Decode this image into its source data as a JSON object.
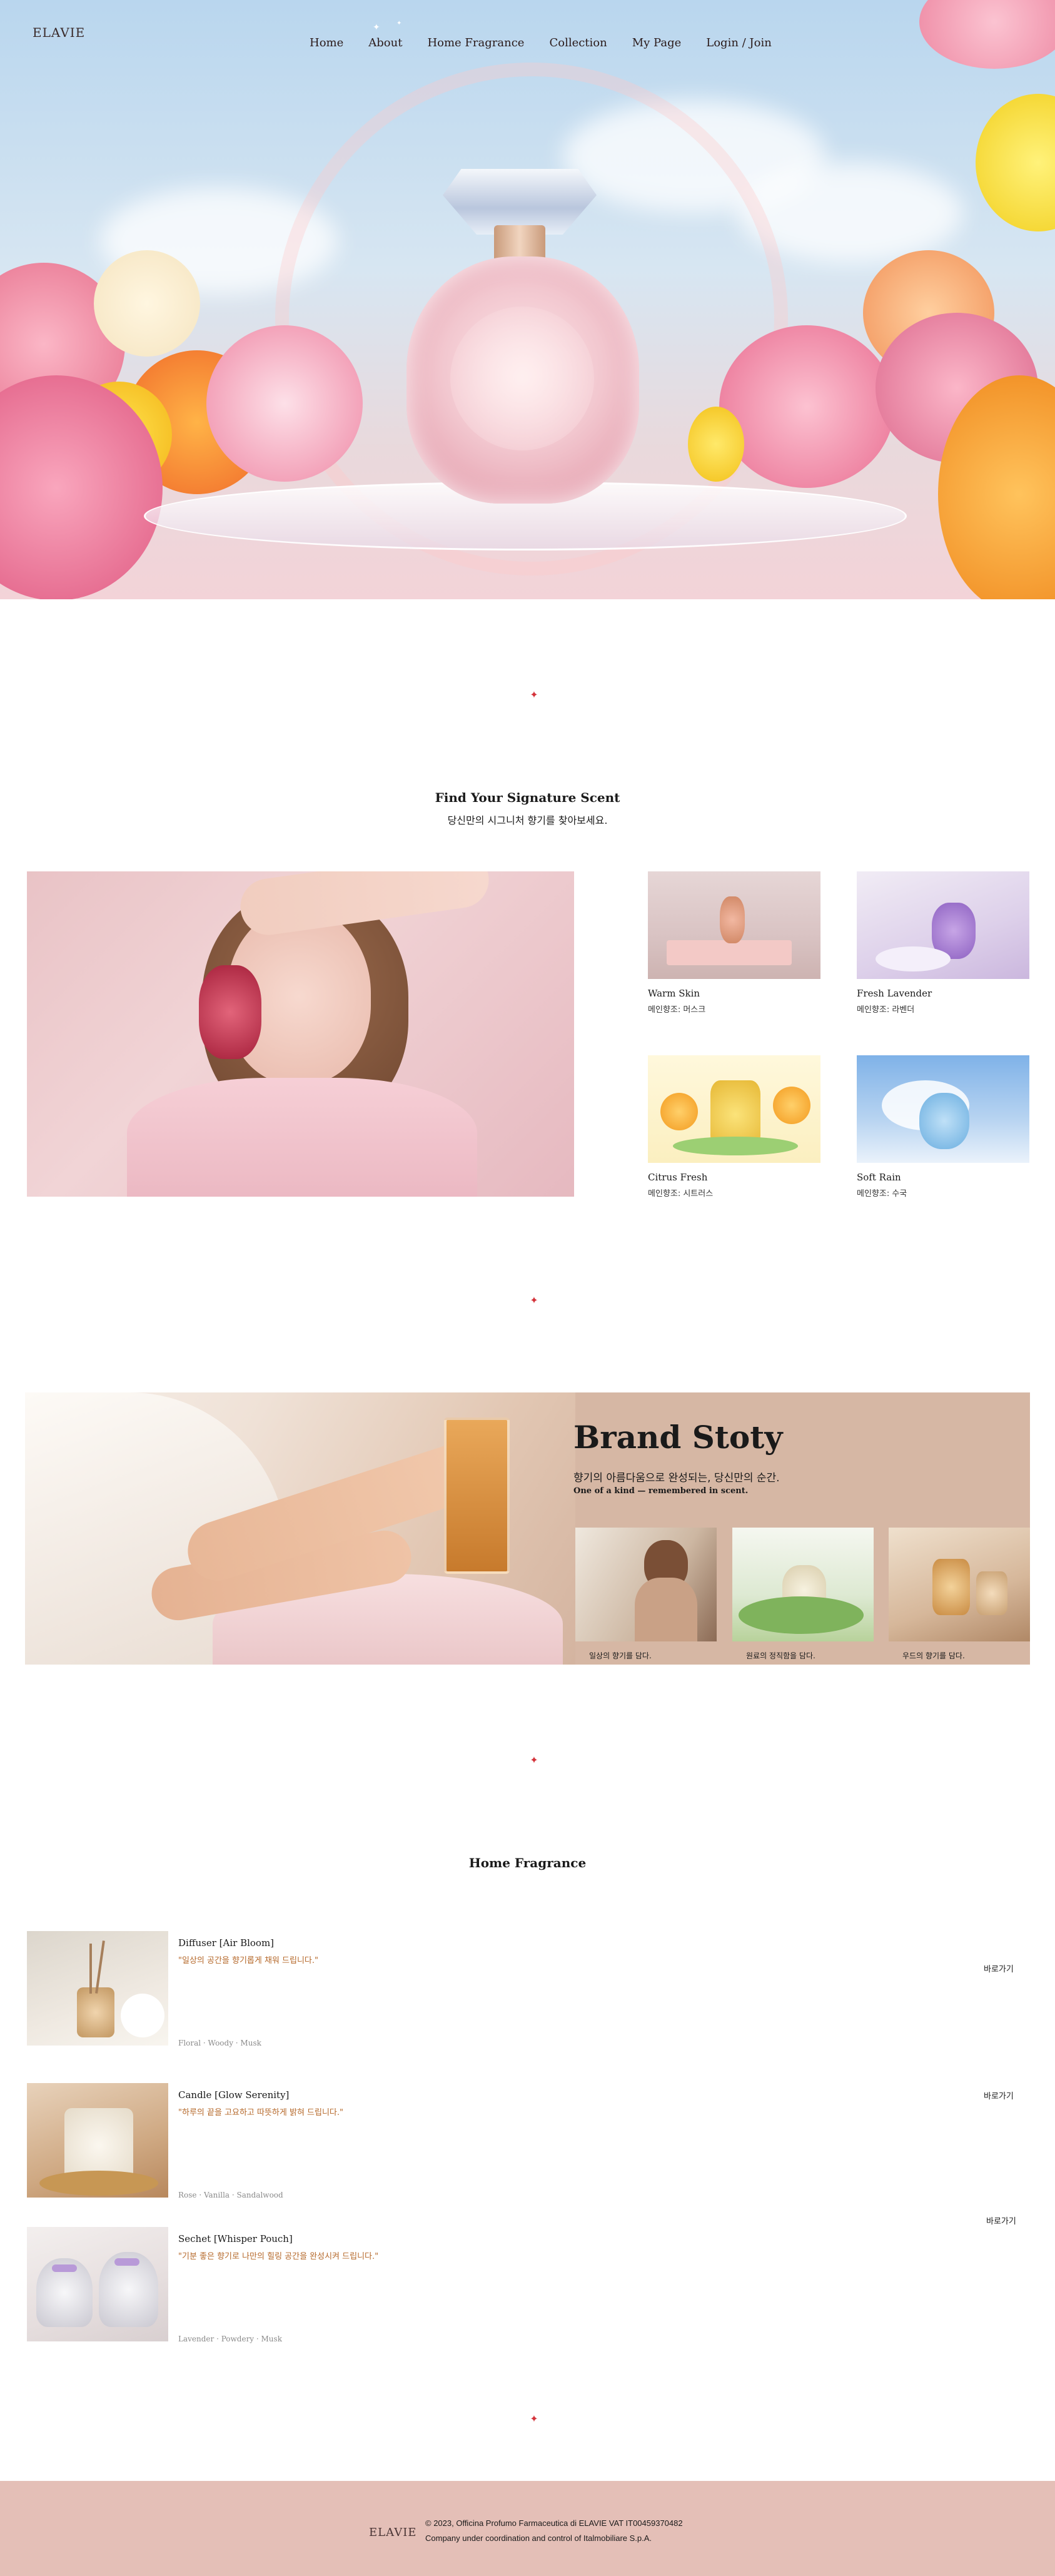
{
  "header": {
    "logo": "ELAVIE",
    "nav": [
      "Home",
      "About",
      "Home Fragrance",
      "Collection",
      "My Page",
      "Login / Join"
    ]
  },
  "divider_icon": "red-sparkle-icon",
  "scent_section": {
    "title": "Find Your Signature Scent",
    "subtitle": "당신만의 시그니처 향기를 찾아보세요.",
    "cards": [
      {
        "name": "Warm Skin",
        "note": "메인향조: 머스크"
      },
      {
        "name": "Fresh Lavender",
        "note": "메인향조: 라벤더"
      },
      {
        "name": "Citrus Fresh",
        "note": "메인향조: 시트러스"
      },
      {
        "name": "Soft Rain",
        "note": "메인향조: 수국"
      }
    ]
  },
  "brand_story": {
    "title": "Brand Stoty",
    "ko": "향기의 아름다움으로 완성되는, 당신만의 순간.",
    "en": "One of a kind — remembered in scent.",
    "tiles": [
      {
        "caption": "일상의 향기를 담다."
      },
      {
        "caption": "원료의 정직함을 담다."
      },
      {
        "caption": "우드의 향기를 담다."
      }
    ]
  },
  "home_fragrance": {
    "title": "Home Fragrance",
    "items": [
      {
        "name": "Diffuser [Air Bloom]",
        "desc": "\"일상의 공간을 향기롭게 채워 드립니다.\"",
        "notes": "Floral · Woody · Musk",
        "link": "바로가기"
      },
      {
        "name": "Candle [Glow Serenity]",
        "desc": "\"하루의 끝을 고요하고 따뜻하게 밝혀 드립니다.\"",
        "notes": "Rose · Vanilla · Sandalwood",
        "link": "바로가기"
      },
      {
        "name": "Sechet [Whisper Pouch]",
        "desc": "\"기분 좋은 향기로 나만의 힐링 공간을 완성시켜 드립니다.\"",
        "notes": "Lavender · Powdery · Musk",
        "link": "바로가기"
      }
    ]
  },
  "footer": {
    "logo": "ELAVIE",
    "line1": "© 2023, Officina Profumo Farmaceutica di ELAVIE VAT IT00459370482",
    "line2": "Company under coordination and control of Italmobiliare S.p.A."
  },
  "colors": {
    "accent_orange": "#b5682a",
    "footer_bg": "#e4bfb7",
    "brand_bg": "#d6b7a4",
    "divider_red": "#d4323a"
  }
}
